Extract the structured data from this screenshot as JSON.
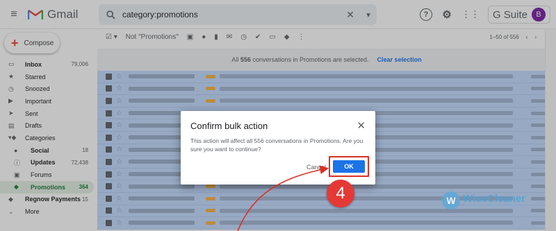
{
  "header": {
    "app_name": "Gmail",
    "search_value": "category:promotions",
    "search_clear": "✕",
    "gsuite_label": "G Suite",
    "avatar_initial": "B",
    "help_icon": "?",
    "settings_icon": "⚙"
  },
  "sidebar": {
    "compose_label": "Compose",
    "items": [
      {
        "label": "Inbox",
        "count": "79,006",
        "icon": "inbox-icon"
      },
      {
        "label": "Starred",
        "count": "",
        "icon": "star-icon"
      },
      {
        "label": "Snoozed",
        "count": "",
        "icon": "clock-icon"
      },
      {
        "label": "Important",
        "count": "",
        "icon": "important-icon"
      },
      {
        "label": "Sent",
        "count": "",
        "icon": "send-icon"
      },
      {
        "label": "Drafts",
        "count": "",
        "icon": "draft-icon"
      },
      {
        "label": "Categories",
        "count": "",
        "icon": "label-icon"
      },
      {
        "label": "Social",
        "count": "18",
        "icon": "people-icon"
      },
      {
        "label": "Updates",
        "count": "72,438",
        "icon": "info-icon"
      },
      {
        "label": "Forums",
        "count": "",
        "icon": "forum-icon"
      },
      {
        "label": "Promotions",
        "count": "364",
        "icon": "tag-icon"
      },
      {
        "label": "Regnow Payments",
        "count": "15",
        "icon": "label-icon"
      },
      {
        "label": "More",
        "count": "",
        "icon": "chevron-down-icon"
      }
    ]
  },
  "toolbar": {
    "filter_label": "Not \"Promotions\"",
    "pagination": "1–50 of 556"
  },
  "banner": {
    "message_prefix": "All ",
    "count": "556",
    "message_suffix": " conversations in Promotions are selected.",
    "clear_label": "Clear selection"
  },
  "dialog": {
    "title": "Confirm bulk action",
    "body": "This action will affect all 556 conversations in Promotions. Are you sure you want to continue?",
    "cancel_label": "Cancel",
    "ok_label": "OK",
    "close_glyph": "✕"
  },
  "annotation": {
    "step_number": "4",
    "highlight_color": "#d93025"
  },
  "watermark": {
    "name": "WiseCleaner",
    "tagline": "Advanced PC Tune-up Utilities",
    "logo_letter": "W"
  },
  "colors": {
    "accent": "#1a73e8",
    "selected_row": "#c2dbff",
    "promotions_green": "#188038",
    "step_badge": "#e53935"
  }
}
